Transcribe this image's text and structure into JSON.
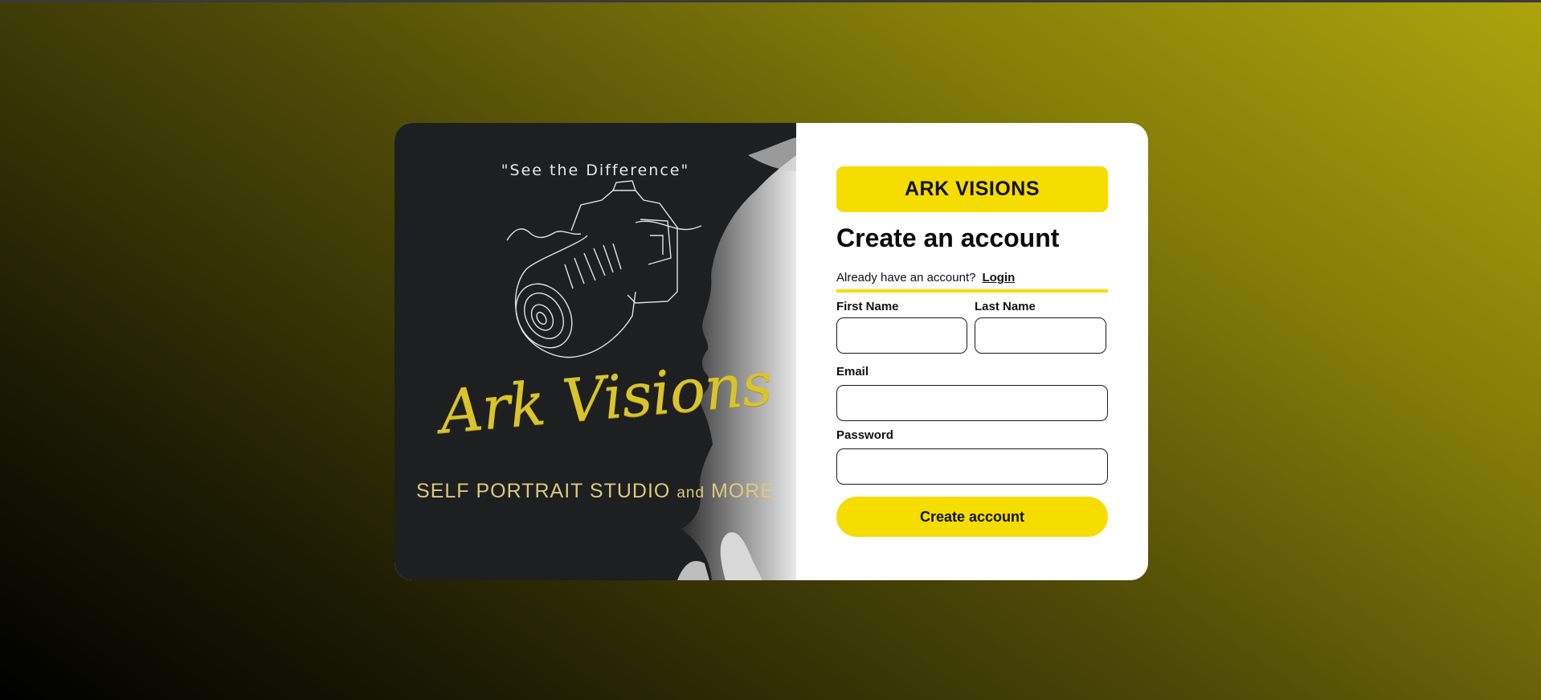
{
  "poster": {
    "tagline": "\"See the Difference\"",
    "brand_script": "Ark Visions",
    "subtitle_a": "SELF PORTRAIT STUDIO ",
    "subtitle_b": "and",
    "subtitle_c": " MORE"
  },
  "form": {
    "brand": "ARK VISIONS",
    "title": "Create an account",
    "have_account": "Already have an account?",
    "login_link": "Login",
    "first_name_label": "First Name",
    "first_name_value": "",
    "last_name_label": "Last Name",
    "last_name_value": "",
    "email_label": "Email",
    "email_value": "",
    "password_label": "Password",
    "password_value": "",
    "submit_label": "Create account"
  },
  "colors": {
    "accent": "#f5dd00",
    "card_bg": "#ffffff",
    "poster_bg": "#1e1f20",
    "script_gold": "#d9c52a"
  }
}
